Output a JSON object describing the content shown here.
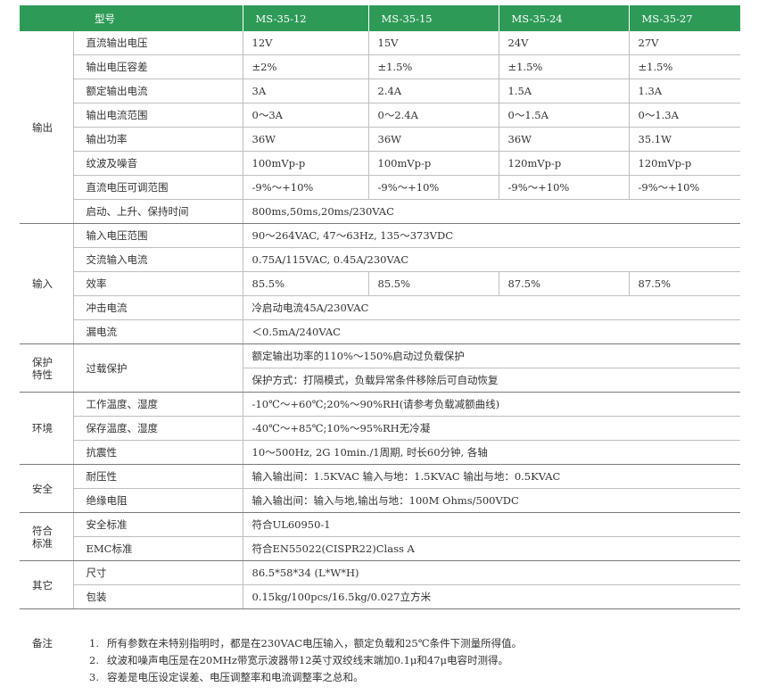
{
  "header": [
    "型号",
    "MS-35-12",
    "MS-35-15",
    "MS-35-24",
    "MS-35-27"
  ],
  "output": {
    "category": "输出",
    "rows": [
      {
        "param": "直流输出电压",
        "values": [
          "12V",
          "15V",
          "24V",
          "27V"
        ]
      },
      {
        "param": "输出电压容差",
        "values": [
          "±2%",
          "±1.5%",
          "±1.5%",
          "±1.5%"
        ]
      },
      {
        "param": "额定输出电流",
        "values": [
          "3A",
          "2.4A",
          "1.5A",
          "1.3A"
        ]
      },
      {
        "param": "输出电流范围",
        "values": [
          "0～3A",
          "0～2.4A",
          "0～1.5A",
          "0～1.3A"
        ]
      },
      {
        "param": "输出功率",
        "values": [
          "36W",
          "36W",
          "36W",
          "35.1W"
        ]
      },
      {
        "param": "纹波及噪音",
        "values": [
          "100mVp-p",
          "100mVp-p",
          "120mVp-p",
          "120mVp-p"
        ]
      },
      {
        "param": "直流电压可调范围",
        "values": [
          "-9%～+10%",
          "-9%～+10%",
          "-9%～+10%",
          "-9%～+10%"
        ]
      },
      {
        "param": "启动、上升、保持时间",
        "value": "800ms,50ms,20ms/230VAC"
      }
    ]
  },
  "input": {
    "category": "输入",
    "rows": [
      {
        "param": "输入电压范围",
        "value": "90～264VAC, 47～63Hz, 135～373VDC"
      },
      {
        "param": "交流输入电流",
        "value": "0.75A/115VAC,  0.45A/230VAC"
      },
      {
        "param": "效率",
        "values": [
          "85.5%",
          "85.5%",
          "87.5%",
          "87.5%"
        ]
      },
      {
        "param": "冲击电流",
        "value": "冷启动电流45A/230VAC"
      },
      {
        "param": "漏电流",
        "value": "＜0.5mA/240VAC"
      }
    ]
  },
  "protection": {
    "category_line1": "保护",
    "category_line2": "特性",
    "param": "过载保护",
    "values": [
      "额定输出功率的110%～150%启动过负载保护",
      "保护方式：打隔模式，负载异常条件移除后可自动恢复"
    ]
  },
  "environment": {
    "category": "环境",
    "rows": [
      {
        "param": "工作温度、湿度",
        "value": "-10℃～+60℃;20%～90%RH(请参考负载减额曲线)"
      },
      {
        "param": "保存温度、湿度",
        "value": "-40℃～+85℃;10%～95%RH无冷凝"
      },
      {
        "param": "抗震性",
        "value": "10～500Hz, 2G 10min./1周期, 时长60分钟, 各轴"
      }
    ]
  },
  "safety": {
    "category": "安全",
    "rows": [
      {
        "param": "耐压性",
        "value": "输入输出间：1.5KVAC    输入与地：1.5KVAC    输出与地：0.5KVAC"
      },
      {
        "param": "绝缘电阻",
        "value": "输入输出间：输入与地,输出与地：100M Ohms/500VDC"
      }
    ]
  },
  "standards": {
    "category_line1": "符合",
    "category_line2": "标准",
    "rows": [
      {
        "param": "安全标准",
        "value": "符合UL60950-1"
      },
      {
        "param": "EMC标准",
        "value": "符合EN55022(CISPR22)Class A"
      }
    ]
  },
  "other": {
    "category": "其它",
    "rows": [
      {
        "param": "尺寸",
        "value": "86.5*58*34 (L*W*H)"
      },
      {
        "param": "包装",
        "value": "0.15kg/100pcs/16.5kg/0.027立方米"
      }
    ]
  },
  "notes": {
    "label": "备注",
    "items": [
      {
        "num": "1.",
        "text": "所有参数在未特别指明时，都是在230VAC电压输入，额定负载和25℃条件下测量所得值。"
      },
      {
        "num": "2.",
        "text": "纹波和噪声电压是在20MHz带宽示波器带12英寸双绞线末端加0.1μ和47μ电容时测得。"
      },
      {
        "num": "3.",
        "text": "容差是电压设定误差、电压调整率和电流调整率之总和。"
      }
    ]
  }
}
